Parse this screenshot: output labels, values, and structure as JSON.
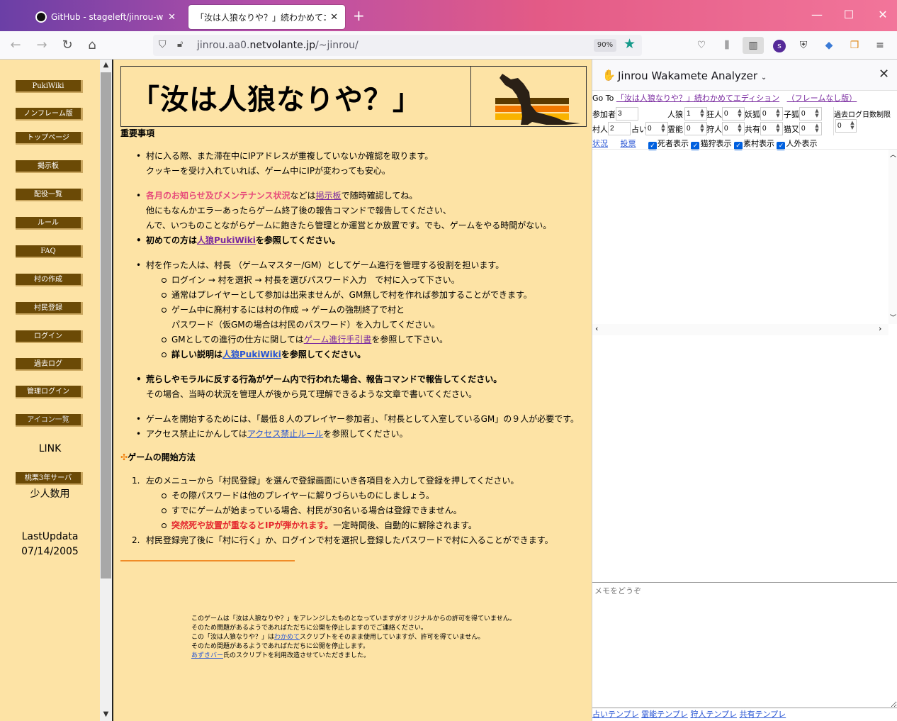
{
  "browser": {
    "tabs": [
      {
        "title": "GitHub - stageleft/jinrou-wakam",
        "active": false
      },
      {
        "title": "「汝は人狼なりや？」続わかめてエディシ",
        "active": true
      }
    ],
    "url_host_prefix": "jinrou.aa0.",
    "url_host_main": "netvolante.jp",
    "url_path": "/~jinrou/",
    "zoom": "90%"
  },
  "left_menu": {
    "items": [
      "PukiWiki",
      "ノンフレーム版",
      "トップページ",
      "掲示板",
      "配役一覧",
      "ルール",
      "FAQ",
      "村の作成",
      "村民登録",
      "ログイン",
      "過去ログ",
      "管理ログイン",
      "アイコン一覧"
    ],
    "link_label": "LINK",
    "server_button": "桃栗3年サーバ",
    "server_caption": "少人数用",
    "lastupdate_label": "LastUpdata",
    "lastupdate_date": "07/14/2005"
  },
  "main": {
    "title": "「汝は人狼なりや？」",
    "important_heading": "重要事項",
    "b1_l1": "村に入る際、また滞在中にIPアドレスが重複していないか確認を取ります。",
    "b1_l2": "クッキーを受け入れていれば、ゲーム中にIPが変わっても安心。",
    "b2_pink": "各月のお知らせ及びメンテナンス状況",
    "b2_mid": "などは",
    "b2_link": "掲示板",
    "b2_tail": "で随時確認してね。",
    "b2_l2": "他にもなんかエラーあったらゲーム終了後の報告コマンドで報告してください、",
    "b2_l3": "んで、いつものことながらゲームに飽きたら管理とか運営とか放置です。でも、ゲームをやる時間がない。",
    "b3_pre": "初めての方は",
    "b3_link": "人狼PukiWiki",
    "b3_tail": "を参照してください。",
    "b4": "村を作った人は、村長 （ゲームマスター/GM）としてゲーム進行を管理する役割を担います。",
    "b4_s1": "ログイン → 村を選択 → 村長を選びパスワード入力　で村に入って下さい。",
    "b4_s2": "通常はプレイヤーとして参加は出来ませんが、GM無しで村を作れば参加することができます。",
    "b4_s3a": "ゲーム中に廃村するには村の作成 → ゲームの強制終了で村と",
    "b4_s3b": "パスワード（仮GMの場合は村民のパスワード）を入力してください。",
    "b4_s4_pre": "GMとしての進行の仕方に関しては",
    "b4_s4_link": "ゲーム進行手引書",
    "b4_s4_tail": "を参照して下さい。",
    "b4_s5_pre": "詳しい説明は",
    "b4_s5_link": "人狼PukiWiki",
    "b4_s5_tail": "を参照してください。",
    "b5_l1": "荒らしやモラルに反する行為がゲーム内で行われた場合、報告コマンドで報告してください。",
    "b5_l2": "その場合、当時の状況を管理人が後から見て理解できるような文章で書いてください。",
    "b6": "ゲームを開始するためには、「最低８人のプレイヤー参加者」、「村長として入室しているGM」の９人が必要です。",
    "b7_pre": "アクセス禁止にかんしては",
    "b7_link": "アクセス禁止ルール",
    "b7_tail": "を参照してください。",
    "start_heading": "ゲームの開始方法",
    "o1": "左のメニューから「村民登録」を選んで登録画面にいき各項目を入力して登録を押してください。",
    "o1_s1": "その際パスワードは他のプレイヤーに解りづらいものにしましょう。",
    "o1_s2": "すでにゲームが始まっている場合、村民が30名いる場合は登録できません。",
    "o1_s3_red": "突然死や放置が重なるとIPが弾かれます。",
    "o1_s3_tail": "一定時間後、自動的に解除されます。",
    "o2": "村民登録完了後に「村に行く」か、ログインで村を選択し登録したパスワードで村に入ることができます。",
    "footer_l1": "このゲームは「汝は人狼なりや？」をアレンジしたものとなっていますがオリジナルからの許可を得ていません。",
    "footer_l2": "そのため問題があるようであればただちに公開を停止しますのでご連絡ください。",
    "footer_l3_pre": "この「汝は人狼なりや？」は",
    "footer_l3_link": "わかめて",
    "footer_l3_tail": "スクリプトをそのまま使用していますが、許可を得ていません。",
    "footer_l4": "そのため問題があるようであればただちに公開を停止します。",
    "footer_l5_link": "あずきバー",
    "footer_l5_tail": "氏のスクリプトを利用改造させていただきました。"
  },
  "panel": {
    "title": "Jinrou Wakamete Analyzer",
    "goto_label": "Go To",
    "goto_link1": "「汝は人狼なりや？」続わかめてエディション",
    "goto_link2": "（フレームなし版）",
    "counters": [
      {
        "label": "参加者",
        "value": "3"
      },
      {
        "label": "人狼",
        "value": "1"
      },
      {
        "label": "狂人",
        "value": "0"
      },
      {
        "label": "妖狐",
        "value": "0"
      },
      {
        "label": "子狐",
        "value": "0"
      },
      {
        "label": "村人",
        "value": "2"
      },
      {
        "label": "占い",
        "value": "0"
      },
      {
        "label": "霊能",
        "value": "0"
      },
      {
        "label": "狩人",
        "value": "0"
      },
      {
        "label": "共有",
        "value": "0"
      },
      {
        "label": "猫又",
        "value": "0"
      }
    ],
    "pastlog_label": "過去ログ日数制限",
    "pastlog_value": "0",
    "link_status": "状況",
    "link_vote": "投票",
    "checks": [
      "死者表示",
      "猫狩表示",
      "素村表示",
      "人外表示"
    ],
    "memo_placeholder": "メモをどうぞ",
    "templates": [
      "占いテンプレ",
      "霊能テンプレ",
      "狩人テンプレ",
      "共有テンプレ"
    ]
  }
}
